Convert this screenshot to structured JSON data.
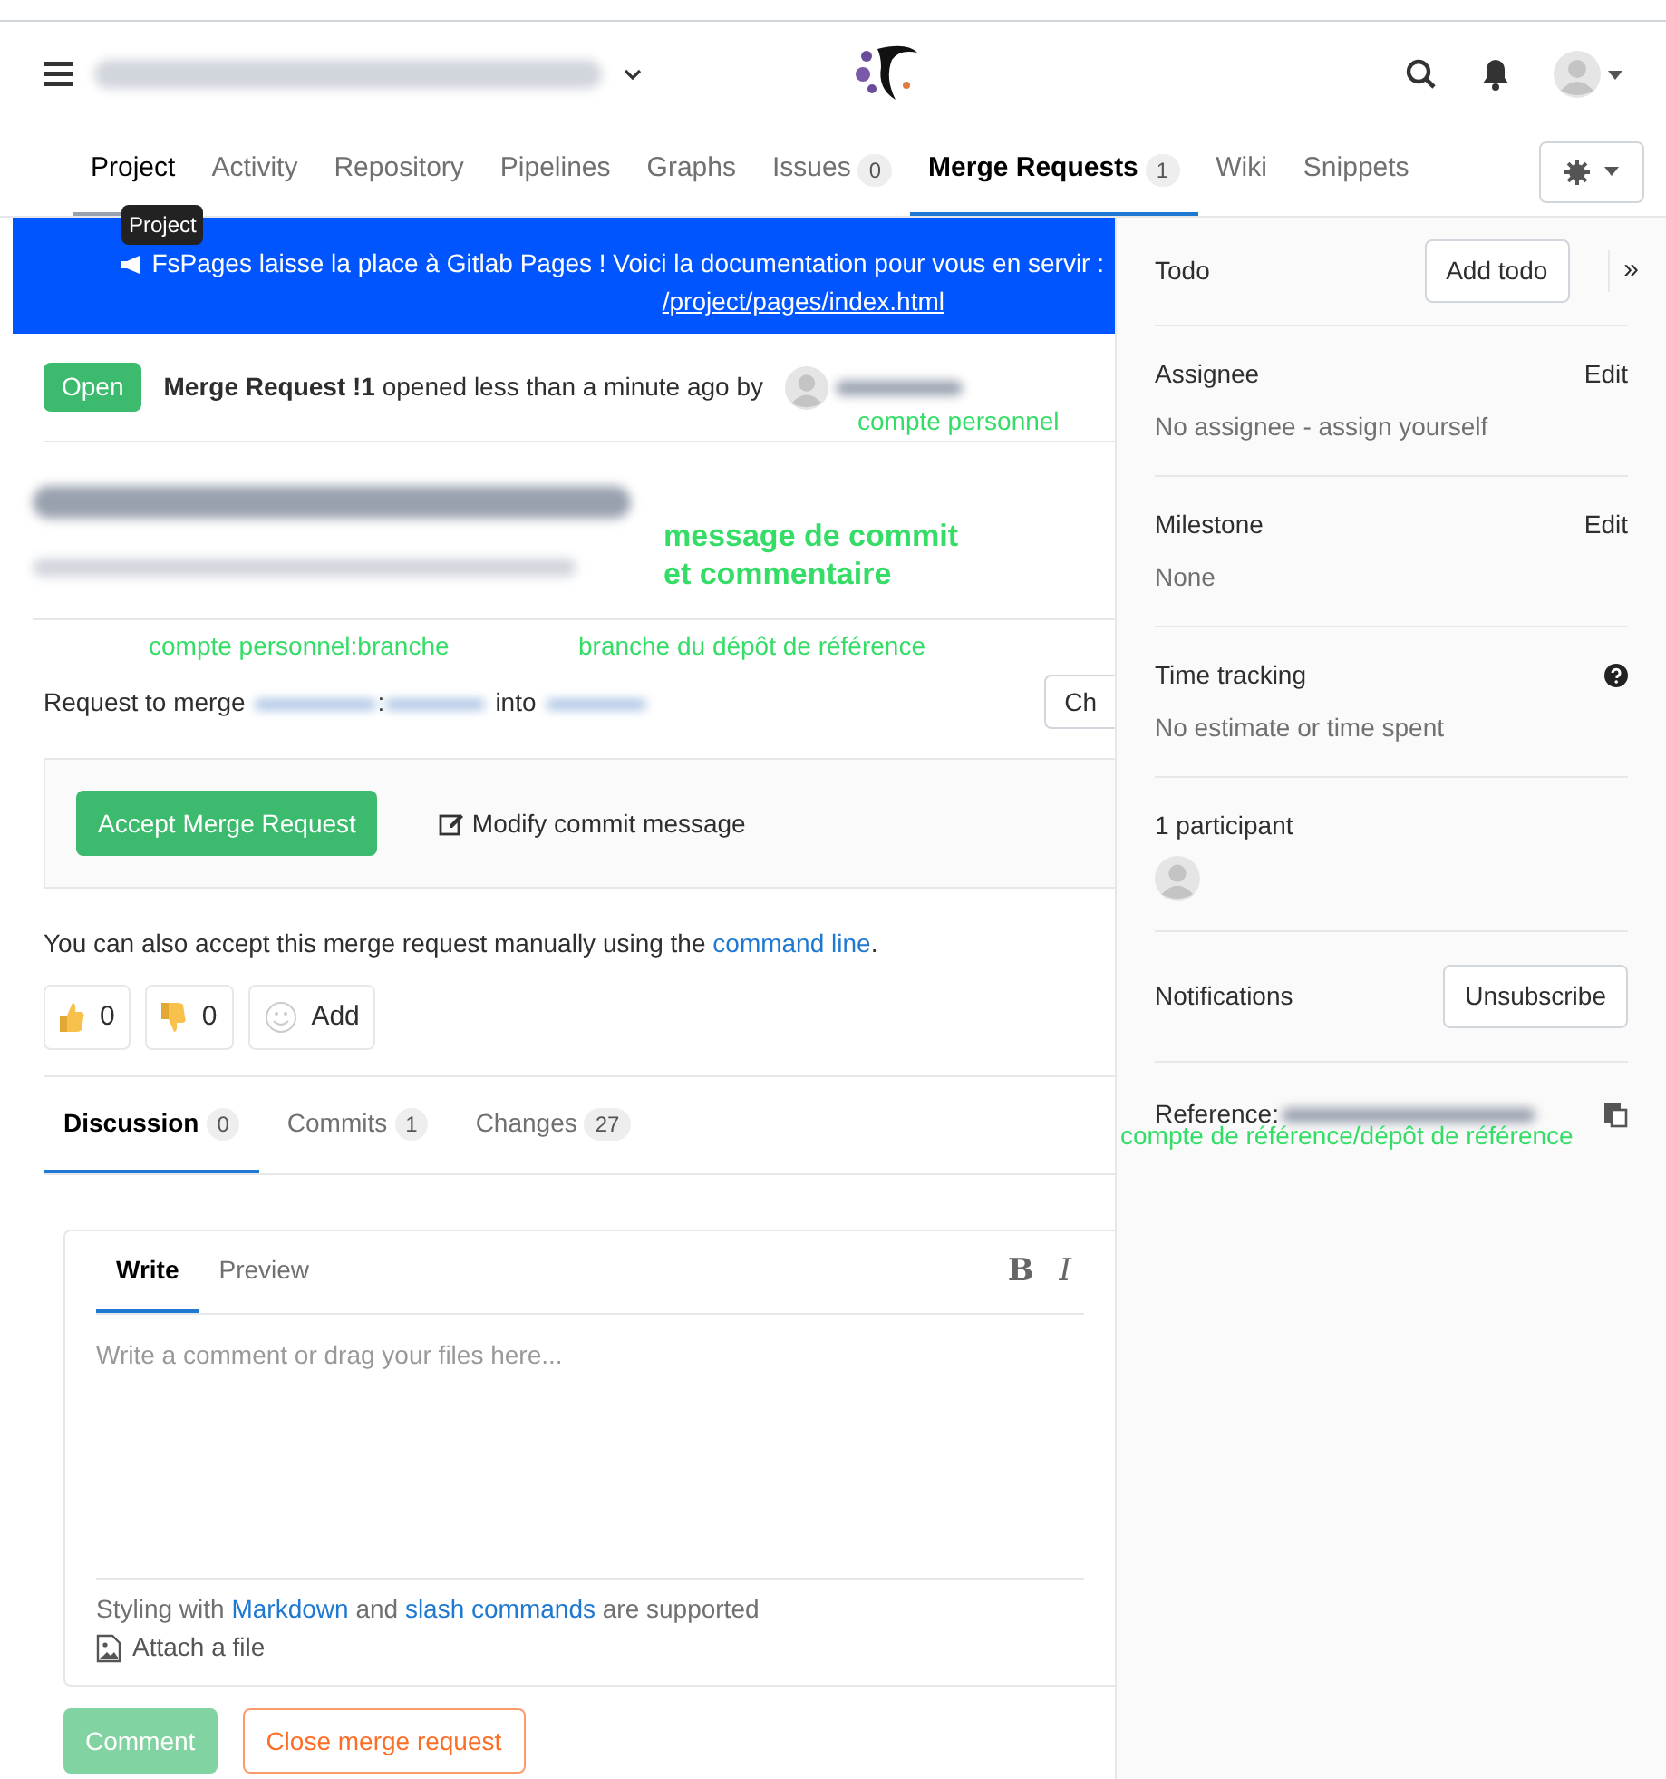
{
  "nav_tabs": [
    {
      "label": "Project",
      "selected": false,
      "hovered": true
    },
    {
      "label": "Activity",
      "selected": false,
      "hovered": false
    },
    {
      "label": "Repository",
      "selected": false,
      "hovered": false
    },
    {
      "label": "Pipelines",
      "selected": false,
      "hovered": false
    },
    {
      "label": "Graphs",
      "selected": false,
      "hovered": false
    },
    {
      "label": "Issues",
      "count": "0",
      "selected": false,
      "hovered": false
    },
    {
      "label": "Merge Requests",
      "count": "1",
      "selected": true,
      "hovered": false
    },
    {
      "label": "Wiki",
      "selected": false,
      "hovered": false
    },
    {
      "label": "Snippets",
      "selected": false,
      "hovered": false
    }
  ],
  "tooltip": "Project",
  "banner": {
    "text": "FsPages laisse la place à Gitlab Pages ! Voici la documentation pour vous en servir :",
    "link": "/project/pages/index.html"
  },
  "merge_request": {
    "status": "Open",
    "title": "Merge Request !1",
    "meta": "opened less than a minute ago by"
  },
  "branch_line": {
    "prefix": "Request to merge",
    "separator": ":",
    "into": "into",
    "checkout_button": "Ch"
  },
  "accept": {
    "button": "Accept Merge Request",
    "modify": "Modify commit message"
  },
  "manual_note": {
    "text": "You can also accept this merge request manually using the",
    "link": "command line",
    "end": "."
  },
  "awards": [
    {
      "kind": "thumbs_up",
      "label": "0"
    },
    {
      "kind": "thumbs_down",
      "label": "0"
    },
    {
      "kind": "add",
      "label": "Add"
    }
  ],
  "mr_tabs": [
    {
      "label": "Discussion",
      "count": "0",
      "selected": true
    },
    {
      "label": "Commits",
      "count": "1",
      "selected": false
    },
    {
      "label": "Changes",
      "count": "27",
      "selected": false
    }
  ],
  "editor": {
    "tabs": [
      {
        "label": "Write",
        "selected": true
      },
      {
        "label": "Preview",
        "selected": false
      }
    ],
    "toolbar": [
      "B",
      "I"
    ],
    "placeholder": "Write a comment or drag your files here...",
    "hint": [
      {
        "kind": "text",
        "text": "Styling with"
      },
      {
        "kind": "link",
        "text": "Markdown"
      },
      {
        "kind": "text",
        "text": "and"
      },
      {
        "kind": "link",
        "text": "slash commands"
      },
      {
        "kind": "text",
        "text": "are supported"
      }
    ],
    "attach": "Attach a file"
  },
  "actions": {
    "comment": "Comment",
    "close": "Close merge request"
  },
  "sidebar": {
    "todo": {
      "label": "Todo",
      "button": "Add todo",
      "collapse": "»"
    },
    "sections": [
      {
        "kind": "edit",
        "title": "Assignee",
        "action": "Edit",
        "value": "No assignee - assign yourself"
      },
      {
        "kind": "edit",
        "title": "Milestone",
        "action": "Edit",
        "value": "None"
      },
      {
        "kind": "help",
        "title": "Time tracking",
        "value": "No estimate or time spent"
      },
      {
        "kind": "participants",
        "title": "1 participant"
      },
      {
        "kind": "button",
        "title": "Notifications",
        "action": "Unsubscribe"
      },
      {
        "kind": "reference",
        "title": "Reference:"
      }
    ]
  },
  "annotations": [
    "compte personnel",
    "message de commit\net commentaire",
    "compte personnel:branche",
    "branche du dépôt de référence",
    "compte de référence/dépôt de référence"
  ]
}
